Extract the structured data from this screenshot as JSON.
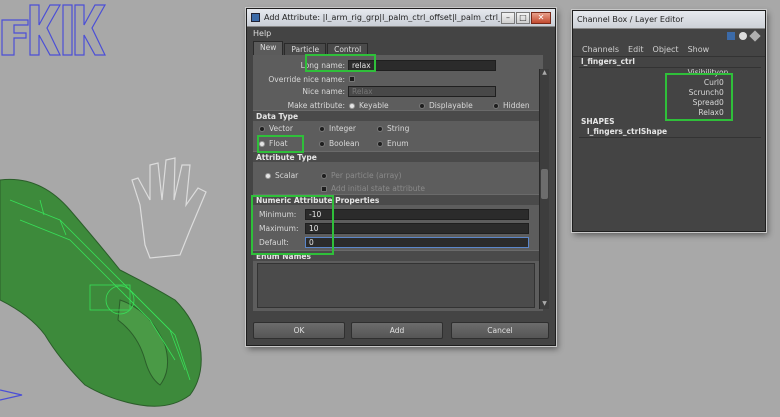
{
  "viewport": {
    "watermark": "KIK"
  },
  "add_attr": {
    "title": "Add Attribute: |l_arm_rig_grp|l_palm_ctrl_offset|l_palm_ctrl_auto|l_palm_ctrl|l...",
    "menu": "Help",
    "tabs": [
      "New",
      "Particle",
      "Control"
    ],
    "long_name_label": "Long name:",
    "long_name_value": "relax",
    "override_label": "Override nice name:",
    "nice_name_label": "Nice name:",
    "nice_name_value": "Relax",
    "make_attr_label": "Make attribute:",
    "make_attr_options": [
      "Keyable",
      "Displayable",
      "Hidden"
    ],
    "data_type_header": "Data Type",
    "data_types": [
      "Vector",
      "Integer",
      "String",
      "Float",
      "Boolean",
      "Enum"
    ],
    "attr_type_header": "Attribute Type",
    "attr_types": [
      "Scalar",
      "Per particle (array)",
      "Add initial state attribute"
    ],
    "numeric_header": "Numeric Attribute Properties",
    "minimum_label": "Minimum:",
    "minimum_value": "-10",
    "maximum_label": "Maximum:",
    "maximum_value": "10",
    "default_label": "Default:",
    "default_value": "0",
    "enum_header": "Enum Names",
    "buttons": [
      "OK",
      "Add",
      "Cancel"
    ]
  },
  "channel_box": {
    "title": "Channel Box / Layer Editor",
    "menu": [
      "Channels",
      "Edit",
      "Object",
      "Show"
    ],
    "node_name": "l_fingers_ctrl",
    "channels": [
      {
        "name": "Visibility",
        "value": "on"
      },
      {
        "name": "Curl",
        "value": "0"
      },
      {
        "name": "Scrunch",
        "value": "0"
      },
      {
        "name": "Spread",
        "value": "0"
      },
      {
        "name": "Relax",
        "value": "0"
      }
    ],
    "shapes_header": "SHAPES",
    "shape_name": "l_fingers_ctrlShape"
  },
  "colors": {
    "highlight": "#2fbf3a",
    "mesh": "#3c8a3c",
    "wire": "#38e058",
    "control": "#5a5ad0"
  }
}
